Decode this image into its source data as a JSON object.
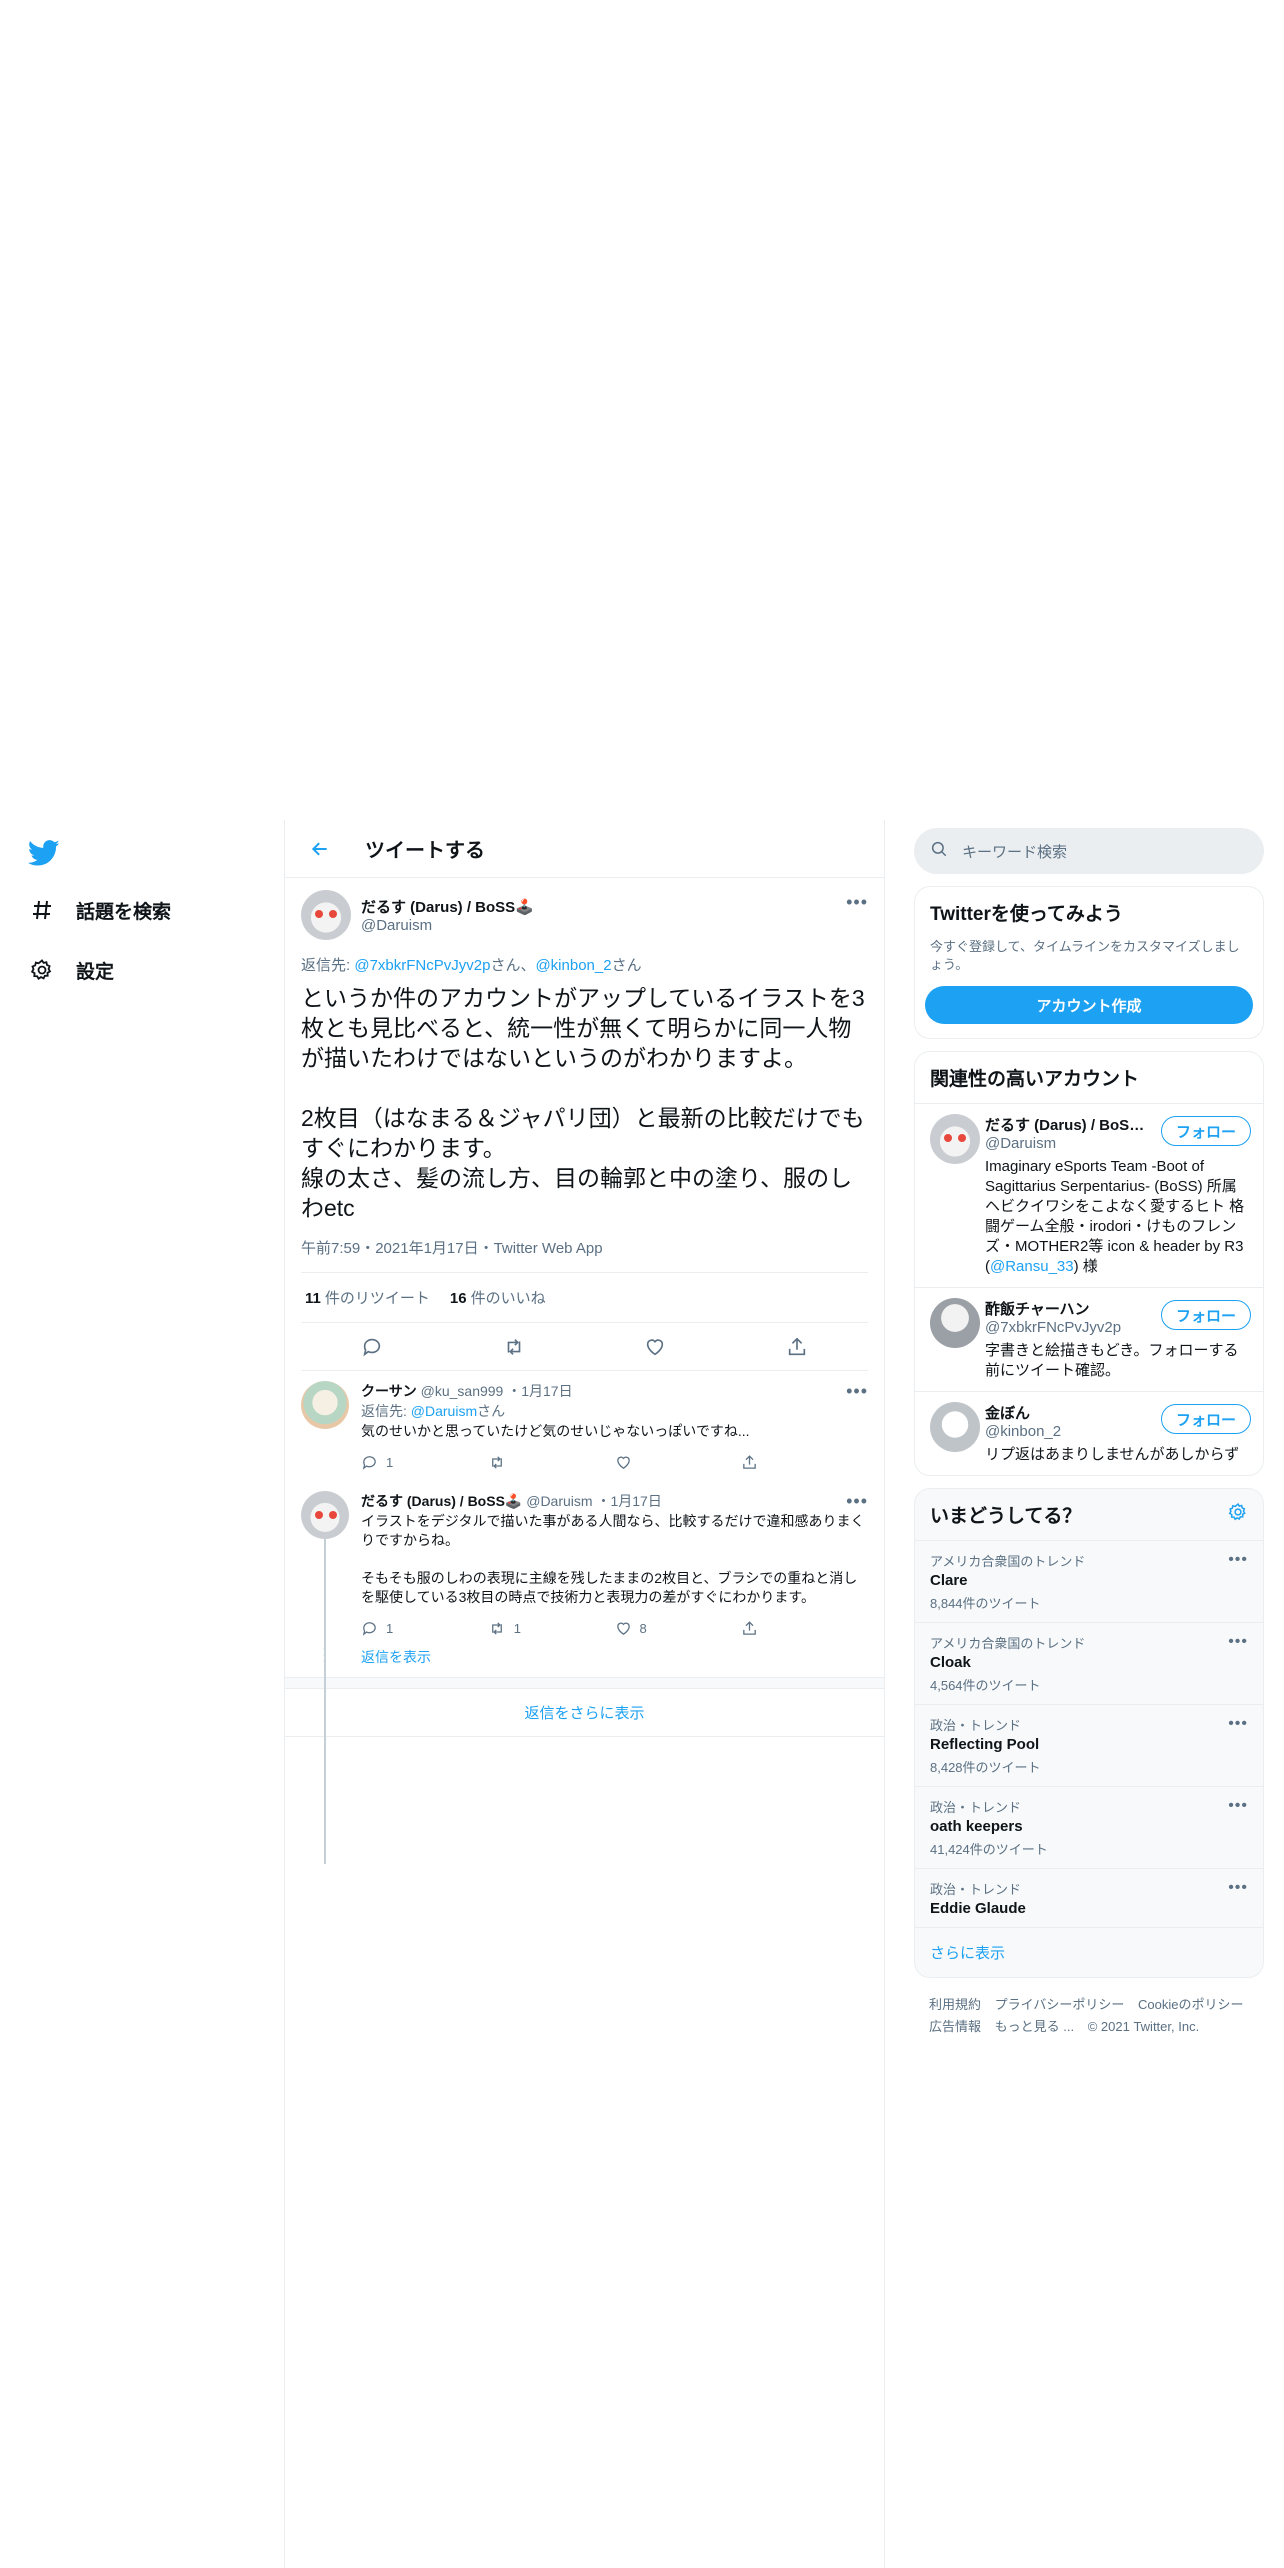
{
  "nav": {
    "items": [
      {
        "label": "話題を検索",
        "icon": "hash-icon"
      },
      {
        "label": "設定",
        "icon": "gear-icon"
      }
    ]
  },
  "header": {
    "title": "ツイートする"
  },
  "tweet": {
    "name": "だるす (Darus) / BoSS🕹️",
    "handle": "@Daruism",
    "reply_prefix": "返信先: ",
    "reply_to_1": "@7xbkrFNcPvJyv2p",
    "reply_mid": "さん、",
    "reply_to_2": "@kinbon_2",
    "reply_suffix": "さん",
    "text": "というか件のアカウントがアップしているイラストを3枚とも見比べると、統一性が無くて明らかに同一人物が描いたわけではないというのがわかりますよ。\n\n2枚目（はなまる＆ジャパリ団）と最新の比較だけでもすぐにわかります。\n線の太さ、髪の流し方、目の輪郭と中の塗り、服のしわetc",
    "meta": "午前7:59・2021年1月17日・Twitter Web App",
    "retweets": "11",
    "retweets_label": "件のリツイート",
    "likes": "16",
    "likes_label": "件のいいね"
  },
  "replies": [
    {
      "name": "クーサン",
      "handle": "@ku_san999",
      "date": "・1月17日",
      "reply_prefix": "返信先: ",
      "reply_to": "@Daruism",
      "reply_suffix": "さん",
      "text": "気のせいかと思っていたけど気のせいじゃないっぽいですね...",
      "reply_count": "1",
      "retweet_count": "",
      "like_count": ""
    },
    {
      "name": "だるす (Darus) / BoSS🕹️",
      "handle": "@Daruism",
      "date": "・1月17日",
      "text": "イラストをデジタルで描いた事がある人間なら、比較するだけで違和感ありまくりですからね。\n\nそもそも服のしわの表現に主線を残したままの2枚目と、ブラシでの重ねと消しを駆使している3枚目の時点で技術力と表現力の差がすぐにわかります。",
      "reply_count": "1",
      "retweet_count": "1",
      "like_count": "8"
    }
  ],
  "show_replies": "返信を表示",
  "show_more_replies": "返信をさらに表示",
  "search": {
    "placeholder": "キーワード検索"
  },
  "signup": {
    "title": "Twitterを使ってみよう",
    "subtitle": "今すぐ登録して、タイムラインをカスタマイズしましょう。",
    "button": "アカウント作成"
  },
  "related": {
    "title": "関連性の高いアカウント",
    "follow_label": "フォロー",
    "accounts": [
      {
        "name": "だるす (Darus) / BoSS🕹️",
        "handle": "@Daruism",
        "bio": "Imaginary eSports Team -Boot of Sagittarius Serpentarius- (BoSS) 所属 ヘビクイワシをこよなく愛するヒト 格闘ゲーム全般・irodori・けものフレンズ・MOTHER2等 icon & header by R3 (",
        "bio_link": "@Ransu_33",
        "bio_end": ") 様"
      },
      {
        "name": "酢飯チャーハン",
        "handle": "@7xbkrFNcPvJyv2p",
        "bio": "字書きと絵描きもどき。フォローする前にツイート確認。"
      },
      {
        "name": "金ぼん",
        "handle": "@kinbon_2",
        "bio": "リプ返はあまりしませんがあしからず"
      }
    ]
  },
  "trends": {
    "title": "いまどうしてる？",
    "items": [
      {
        "context": "アメリカ合衆国のトレンド",
        "title": "Clare",
        "count": "8,844件のツイート"
      },
      {
        "context": "アメリカ合衆国のトレンド",
        "title": "Cloak",
        "count": "4,564件のツイート"
      },
      {
        "context": "政治・トレンド",
        "title": "Reflecting Pool",
        "count": "8,428件のツイート"
      },
      {
        "context": "政治・トレンド",
        "title": "oath keepers",
        "count": "41,424件のツイート"
      },
      {
        "context": "政治・トレンド",
        "title": "Eddie Glaude",
        "count": ""
      }
    ],
    "show_more": "さらに表示"
  },
  "footer": {
    "links": [
      "利用規約",
      "プライバシーポリシー",
      "Cookieのポリシー",
      "広告情報",
      "もっと見る ..."
    ],
    "copyright": "© 2021 Twitter, Inc."
  },
  "colors": {
    "accent": "#1da1f2",
    "text": "#0f1419",
    "secondary": "#5b7083",
    "border": "#ebeef0"
  }
}
